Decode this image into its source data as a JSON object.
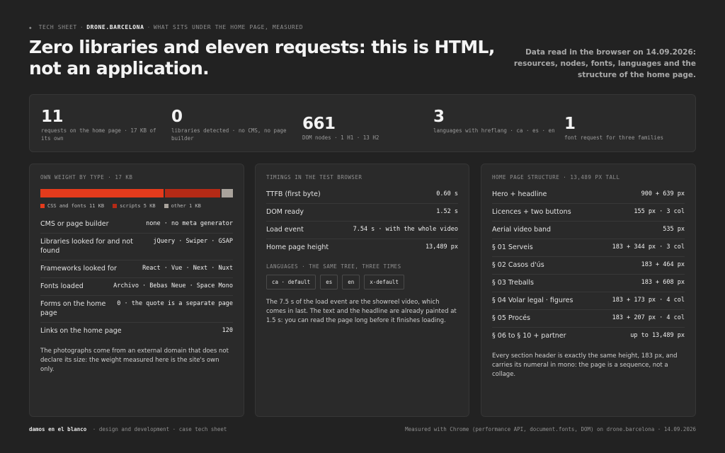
{
  "header": {
    "dot": "◆",
    "crumb": [
      "TECH SHEET",
      "DRONE.BARCELONA",
      "WHAT SITS UNDER THE HOME PAGE, MEASURED"
    ],
    "title": "Zero libraries and eleven requests: this is HTML, not an application.",
    "note": "Data read in the browser on 14.09.2026: resources, nodes, fonts, languages and the structure of the home page."
  },
  "stats": [
    {
      "value": "11",
      "label": "requests on the home page · 17 KB of its own"
    },
    {
      "value": "0",
      "label": "libraries detected · no CMS, no page builder"
    },
    {
      "value": "661",
      "label": "DOM nodes · 1 H1 · 13 H2"
    },
    {
      "value": "3",
      "label": "languages with hreflang · ca · es · en"
    },
    {
      "value": "1",
      "label": "font request for three families"
    }
  ],
  "weight": {
    "title": "OWN WEIGHT BY TYPE · 17 KB",
    "segments": [
      {
        "label": "CSS and fonts 11 KB",
        "kb": 11,
        "color": "#e53b1c"
      },
      {
        "label": "scripts 5 KB",
        "kb": 5,
        "color": "#b52a16"
      },
      {
        "label": "other 1 KB",
        "kb": 1,
        "color": "#a9a39c"
      }
    ],
    "rows": [
      {
        "k": "CMS or page builder",
        "v": "none · no meta generator"
      },
      {
        "k": "Libraries looked for and not found",
        "v": "jQuery · Swiper · GSAP"
      },
      {
        "k": "Frameworks looked for",
        "v": "React · Vue · Next · Nuxt"
      },
      {
        "k": "Fonts loaded",
        "v": "Archivo · Bebas Neue · Space Mono"
      },
      {
        "k": "Forms on the home page",
        "v": "0 · the quote is a separate page"
      },
      {
        "k": "Links on the home page",
        "v": "120"
      }
    ],
    "note": "The photographs come from an external domain that does not declare its size: the weight measured here is the site's own only."
  },
  "timings": {
    "title": "TIMINGS IN THE TEST BROWSER",
    "rows": [
      {
        "k": "TTFB (first byte)",
        "v": "0.60 s"
      },
      {
        "k": "DOM ready",
        "v": "1.52 s"
      },
      {
        "k": "Load event",
        "v": "7.54 s · with the whole video"
      },
      {
        "k": "Home page height",
        "v": "13,489 px"
      }
    ],
    "languages_title": "LANGUAGES · THE SAME TREE, THREE TIMES",
    "languages": [
      "ca · default",
      "es",
      "en",
      "x-default"
    ],
    "note": "The 7.5 s of the load event are the showreel video, which comes in last. The text and the headline are already painted at 1.5 s: you can read the page long before it finishes loading."
  },
  "structure": {
    "title": "HOME PAGE STRUCTURE · 13,489 PX TALL",
    "rows": [
      {
        "k": "Hero + headline",
        "v": "900 + 639 px"
      },
      {
        "k": "Licences + two buttons",
        "v": "155 px · 3 col"
      },
      {
        "k": "Aerial video band",
        "v": "535 px"
      },
      {
        "k": "§ 01 Serveis",
        "v": "183 + 344 px · 3 col"
      },
      {
        "k": "§ 02 Casos d'ús",
        "v": "183 + 464 px"
      },
      {
        "k": "§ 03 Treballs",
        "v": "183 + 608 px"
      },
      {
        "k": "§ 04 Volar legal · figures",
        "v": "183 + 173 px · 4 col"
      },
      {
        "k": "§ 05 Procés",
        "v": "183 + 207 px · 4 col"
      },
      {
        "k": "§ 06 to § 10 + partner",
        "v": "up to 13,489 px"
      }
    ],
    "note": "Every section header is exactly the same height, 183 px, and carries its numeral in mono: the page is a sequence, not a collage."
  },
  "footer": {
    "brand": "damos en el blanco",
    "left": "· design and development · case tech sheet",
    "right": "Measured with Chrome (performance API, document.fonts, DOM) on drone.barcelona · 14.09.2026"
  }
}
